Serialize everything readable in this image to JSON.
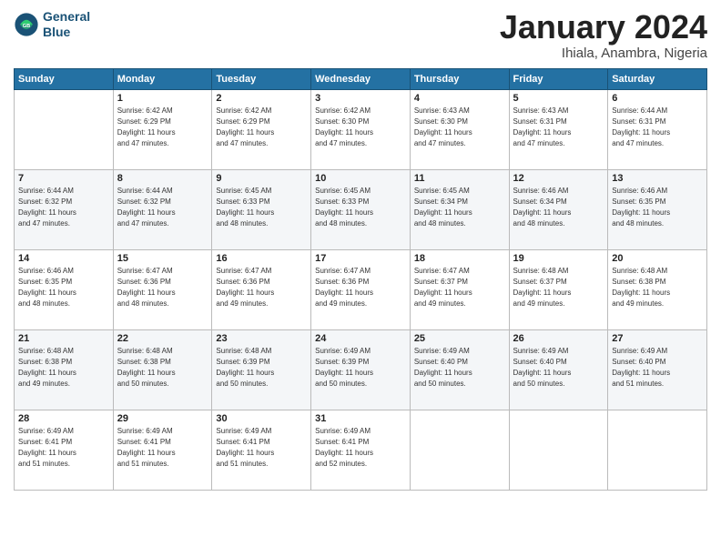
{
  "header": {
    "logo_line1": "General",
    "logo_line2": "Blue",
    "month": "January 2024",
    "location": "Ihiala, Anambra, Nigeria"
  },
  "days_of_week": [
    "Sunday",
    "Monday",
    "Tuesday",
    "Wednesday",
    "Thursday",
    "Friday",
    "Saturday"
  ],
  "weeks": [
    [
      {
        "day": "",
        "info": ""
      },
      {
        "day": "1",
        "info": "Sunrise: 6:42 AM\nSunset: 6:29 PM\nDaylight: 11 hours\nand 47 minutes."
      },
      {
        "day": "2",
        "info": "Sunrise: 6:42 AM\nSunset: 6:29 PM\nDaylight: 11 hours\nand 47 minutes."
      },
      {
        "day": "3",
        "info": "Sunrise: 6:42 AM\nSunset: 6:30 PM\nDaylight: 11 hours\nand 47 minutes."
      },
      {
        "day": "4",
        "info": "Sunrise: 6:43 AM\nSunset: 6:30 PM\nDaylight: 11 hours\nand 47 minutes."
      },
      {
        "day": "5",
        "info": "Sunrise: 6:43 AM\nSunset: 6:31 PM\nDaylight: 11 hours\nand 47 minutes."
      },
      {
        "day": "6",
        "info": "Sunrise: 6:44 AM\nSunset: 6:31 PM\nDaylight: 11 hours\nand 47 minutes."
      }
    ],
    [
      {
        "day": "7",
        "info": "Sunrise: 6:44 AM\nSunset: 6:32 PM\nDaylight: 11 hours\nand 47 minutes."
      },
      {
        "day": "8",
        "info": "Sunrise: 6:44 AM\nSunset: 6:32 PM\nDaylight: 11 hours\nand 47 minutes."
      },
      {
        "day": "9",
        "info": "Sunrise: 6:45 AM\nSunset: 6:33 PM\nDaylight: 11 hours\nand 48 minutes."
      },
      {
        "day": "10",
        "info": "Sunrise: 6:45 AM\nSunset: 6:33 PM\nDaylight: 11 hours\nand 48 minutes."
      },
      {
        "day": "11",
        "info": "Sunrise: 6:45 AM\nSunset: 6:34 PM\nDaylight: 11 hours\nand 48 minutes."
      },
      {
        "day": "12",
        "info": "Sunrise: 6:46 AM\nSunset: 6:34 PM\nDaylight: 11 hours\nand 48 minutes."
      },
      {
        "day": "13",
        "info": "Sunrise: 6:46 AM\nSunset: 6:35 PM\nDaylight: 11 hours\nand 48 minutes."
      }
    ],
    [
      {
        "day": "14",
        "info": "Sunrise: 6:46 AM\nSunset: 6:35 PM\nDaylight: 11 hours\nand 48 minutes."
      },
      {
        "day": "15",
        "info": "Sunrise: 6:47 AM\nSunset: 6:36 PM\nDaylight: 11 hours\nand 48 minutes."
      },
      {
        "day": "16",
        "info": "Sunrise: 6:47 AM\nSunset: 6:36 PM\nDaylight: 11 hours\nand 49 minutes."
      },
      {
        "day": "17",
        "info": "Sunrise: 6:47 AM\nSunset: 6:36 PM\nDaylight: 11 hours\nand 49 minutes."
      },
      {
        "day": "18",
        "info": "Sunrise: 6:47 AM\nSunset: 6:37 PM\nDaylight: 11 hours\nand 49 minutes."
      },
      {
        "day": "19",
        "info": "Sunrise: 6:48 AM\nSunset: 6:37 PM\nDaylight: 11 hours\nand 49 minutes."
      },
      {
        "day": "20",
        "info": "Sunrise: 6:48 AM\nSunset: 6:38 PM\nDaylight: 11 hours\nand 49 minutes."
      }
    ],
    [
      {
        "day": "21",
        "info": "Sunrise: 6:48 AM\nSunset: 6:38 PM\nDaylight: 11 hours\nand 49 minutes."
      },
      {
        "day": "22",
        "info": "Sunrise: 6:48 AM\nSunset: 6:38 PM\nDaylight: 11 hours\nand 50 minutes."
      },
      {
        "day": "23",
        "info": "Sunrise: 6:48 AM\nSunset: 6:39 PM\nDaylight: 11 hours\nand 50 minutes."
      },
      {
        "day": "24",
        "info": "Sunrise: 6:49 AM\nSunset: 6:39 PM\nDaylight: 11 hours\nand 50 minutes."
      },
      {
        "day": "25",
        "info": "Sunrise: 6:49 AM\nSunset: 6:40 PM\nDaylight: 11 hours\nand 50 minutes."
      },
      {
        "day": "26",
        "info": "Sunrise: 6:49 AM\nSunset: 6:40 PM\nDaylight: 11 hours\nand 50 minutes."
      },
      {
        "day": "27",
        "info": "Sunrise: 6:49 AM\nSunset: 6:40 PM\nDaylight: 11 hours\nand 51 minutes."
      }
    ],
    [
      {
        "day": "28",
        "info": "Sunrise: 6:49 AM\nSunset: 6:41 PM\nDaylight: 11 hours\nand 51 minutes."
      },
      {
        "day": "29",
        "info": "Sunrise: 6:49 AM\nSunset: 6:41 PM\nDaylight: 11 hours\nand 51 minutes."
      },
      {
        "day": "30",
        "info": "Sunrise: 6:49 AM\nSunset: 6:41 PM\nDaylight: 11 hours\nand 51 minutes."
      },
      {
        "day": "31",
        "info": "Sunrise: 6:49 AM\nSunset: 6:41 PM\nDaylight: 11 hours\nand 52 minutes."
      },
      {
        "day": "",
        "info": ""
      },
      {
        "day": "",
        "info": ""
      },
      {
        "day": "",
        "info": ""
      }
    ]
  ]
}
